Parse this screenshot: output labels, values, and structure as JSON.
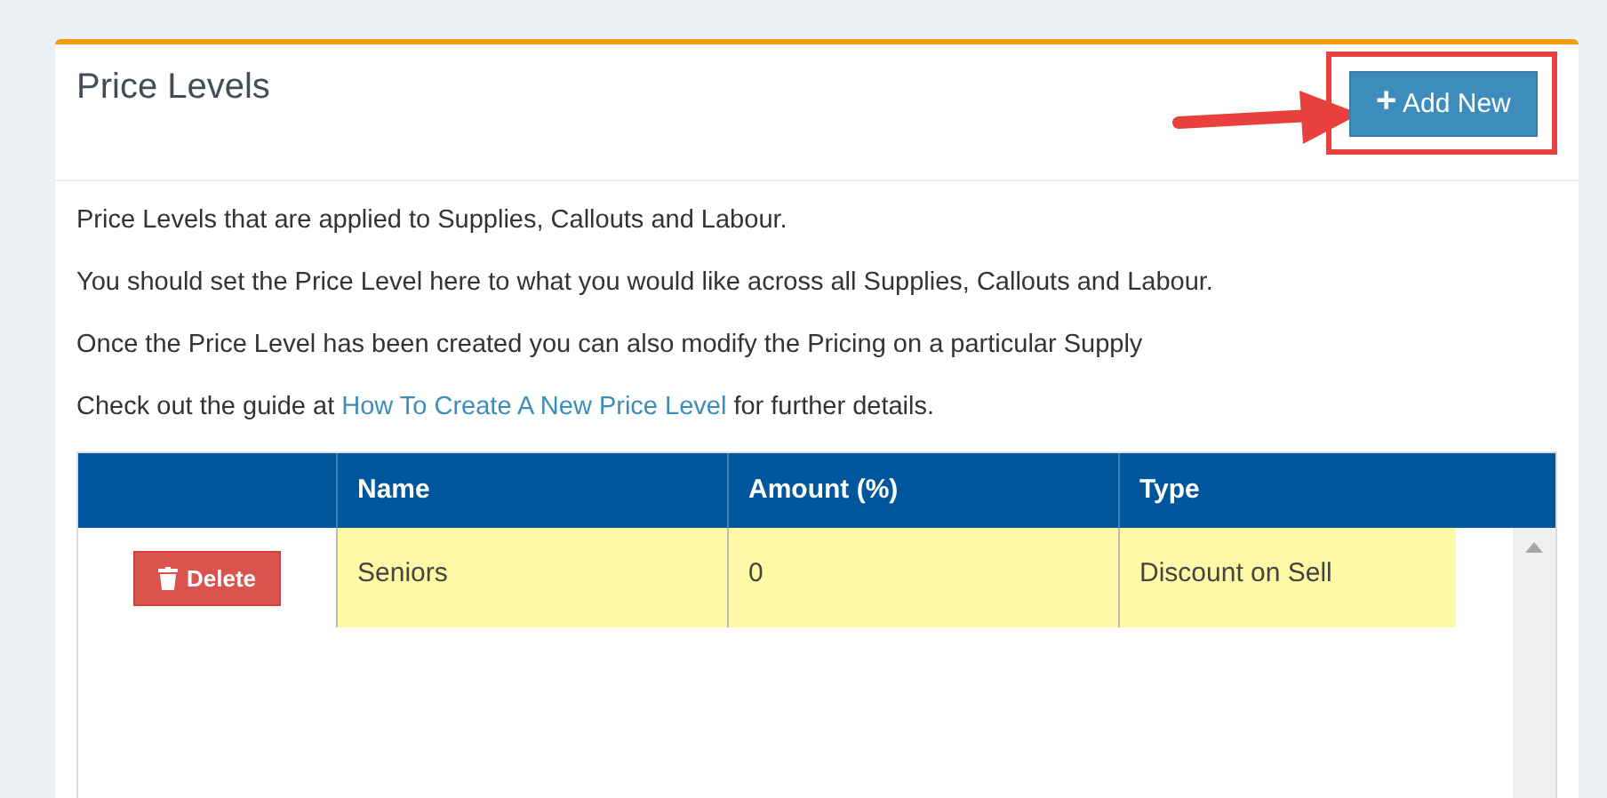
{
  "panel": {
    "title": "Price Levels",
    "add_button": {
      "icon": "+",
      "label": "Add New"
    }
  },
  "description": [
    "Price Levels that are applied to Supplies, Callouts and Labour.",
    "You should set the Price Level here to what you would like across all Supplies, Callouts and Labour.",
    "Once the Price Level has been created you can also modify the Pricing on a particular Supply"
  ],
  "guide": {
    "before": "Check out the guide at",
    "link": "How To Create A New Price Level",
    "after": "for further details."
  },
  "table": {
    "columns": [
      "Name",
      "Amount (%)",
      "Type"
    ],
    "rows": [
      {
        "delete_label": "Delete",
        "cells": [
          "Seniors",
          "0",
          "Discount on Sell"
        ],
        "highlighted": true
      }
    ]
  }
}
